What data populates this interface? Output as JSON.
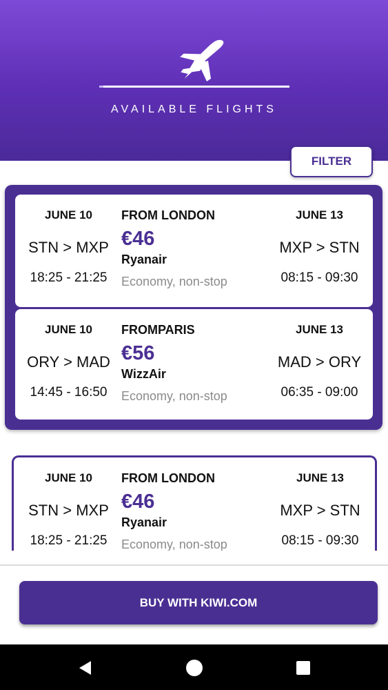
{
  "header": {
    "title": "AVAILABLE FLIGHTS"
  },
  "filter_label": "FILTER",
  "flight_groups": [
    {
      "flights": [
        {
          "outbound_date": "JUNE 10",
          "outbound_route": "STN > MXP",
          "outbound_time": "18:25 - 21:25",
          "origin": "FROM LONDON",
          "price": "€46",
          "airline": "Ryanair",
          "class": "Economy, non-stop",
          "return_date": "JUNE 13",
          "return_route": "MXP > STN",
          "return_time": "08:15 - 09:30"
        },
        {
          "outbound_date": "JUNE 10",
          "outbound_route": "ORY > MAD",
          "outbound_time": "14:45 - 16:50",
          "origin": "FROMPARIS",
          "price": "€56",
          "airline": "WizzAir",
          "class": "Economy, non-stop",
          "return_date": "JUNE 13",
          "return_route": "MAD > ORY",
          "return_time": "06:35 - 09:00"
        }
      ]
    },
    {
      "flights": [
        {
          "outbound_date": "JUNE 10",
          "outbound_route": "STN > MXP",
          "outbound_time": "18:25 - 21:25",
          "origin": "FROM LONDON",
          "price": "€46",
          "airline": "Ryanair",
          "class": "Economy, non-stop",
          "return_date": "JUNE 13",
          "return_route": "MXP > STN",
          "return_time": "08:15 - 09:30"
        }
      ]
    }
  ],
  "buy_label": "BUY WITH KIWI.COM",
  "colors": {
    "accent": "#4a2f93",
    "header_top": "#7d49d6",
    "header_bottom": "#4b2a99"
  },
  "icons": [
    "airplane-icon",
    "back-icon",
    "home-icon",
    "recents-icon"
  ]
}
